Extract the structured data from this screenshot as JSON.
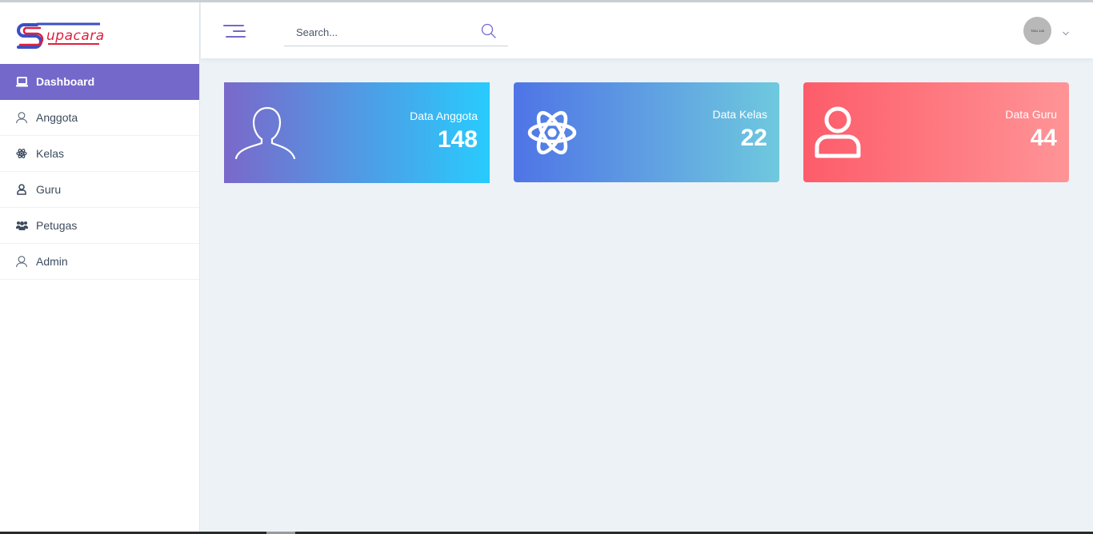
{
  "app": {
    "logo_text": "upacara",
    "brand_colors": {
      "primary": "#7468cb",
      "logo_red": "#e21f3c",
      "logo_blue": "#3b4fc4"
    }
  },
  "sidebar": {
    "items": [
      {
        "label": "Dashboard",
        "icon": "laptop-icon",
        "active": true
      },
      {
        "label": "Anggota",
        "icon": "user-outline-icon",
        "active": false
      },
      {
        "label": "Kelas",
        "icon": "atom-icon",
        "active": false
      },
      {
        "label": "Guru",
        "icon": "person-icon",
        "active": false
      },
      {
        "label": "Petugas",
        "icon": "users-group-icon",
        "active": false
      },
      {
        "label": "Admin",
        "icon": "user-outline-icon",
        "active": false
      }
    ]
  },
  "header": {
    "menu_icon": "hamburger-icon",
    "search": {
      "placeholder": "Search...",
      "value": ""
    },
    "search_icon": "search-icon",
    "avatar_text": "TIDU 100",
    "dropdown_icon": "chevron-down-icon"
  },
  "cards": [
    {
      "label": "Data Anggota",
      "value": "148",
      "icon": "user-outline-icon",
      "gradient": [
        "#7a68ca",
        "#28cbfd"
      ]
    },
    {
      "label": "Data Kelas",
      "value": "22",
      "icon": "atom-icon",
      "gradient": [
        "#4f74e6",
        "#6ec9de"
      ]
    },
    {
      "label": "Data Guru",
      "value": "44",
      "icon": "person-icon",
      "gradient": [
        "#fd5c6a",
        "#fe9496"
      ]
    }
  ]
}
